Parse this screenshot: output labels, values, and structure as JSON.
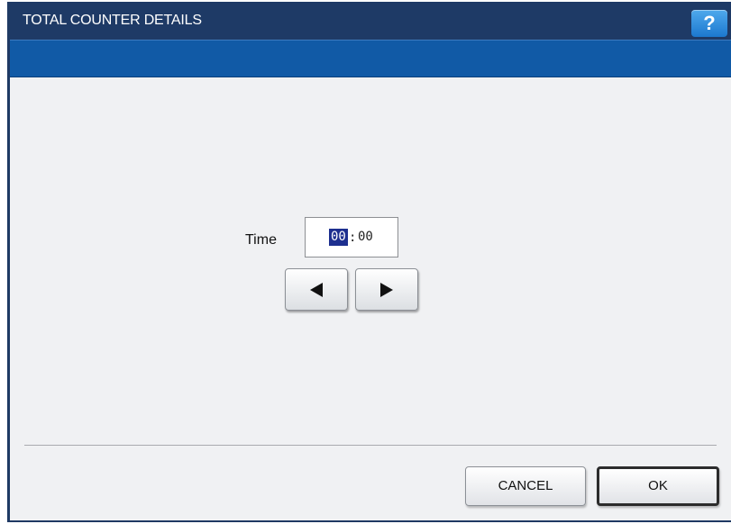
{
  "window": {
    "title": "TOTAL COUNTER DETAILS",
    "help_label": "?"
  },
  "main": {
    "time_label": "Time",
    "time_field": {
      "hours": "00",
      "separator": ":",
      "minutes": "00",
      "selected_segment": "hours"
    },
    "left_arrow_icon": "triangle-left-icon",
    "right_arrow_icon": "triangle-right-icon"
  },
  "footer": {
    "cancel_label": "CANCEL",
    "ok_label": "OK"
  },
  "colors": {
    "titlebar": "#1e3a66",
    "subbar": "#115aa6",
    "help_button": "#2a8ae0",
    "selection": "#1d2f8f",
    "background": "#f0f1f3"
  }
}
